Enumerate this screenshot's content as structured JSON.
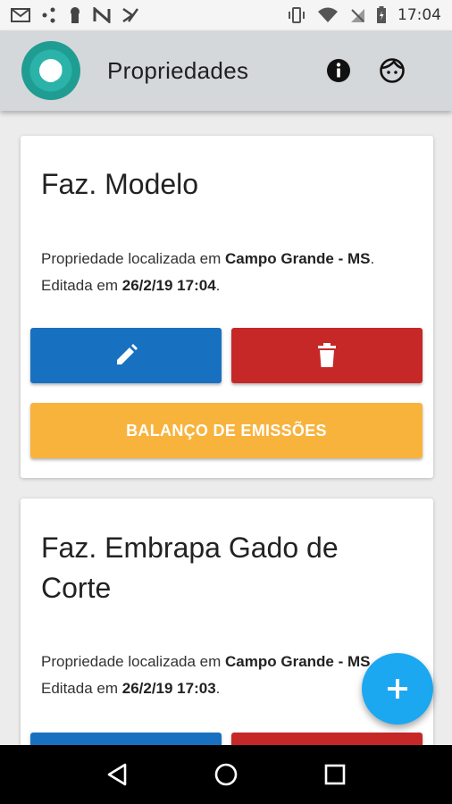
{
  "status_bar": {
    "time": "17:04",
    "icons": [
      "gmail-icon",
      "share-icon",
      "keyhole-icon",
      "app-n-icon",
      "app-check-icon",
      "vibrate-icon",
      "wifi-icon",
      "no-sim-icon",
      "battery-icon"
    ]
  },
  "app_bar": {
    "title": "Propriedades",
    "icons": [
      "info-icon",
      "face-icon"
    ]
  },
  "properties": [
    {
      "name": "Faz. Modelo",
      "desc_prefix": "Propriedade localizada em ",
      "location": "Campo Grande - MS",
      "desc_mid": ". Editada em ",
      "edited": "26/2/19 17:04",
      "desc_suffix": ".",
      "balance_label": "BALANÇO DE EMISSÕES"
    },
    {
      "name_line1": "Faz. Embrapa Gado de",
      "name_line2": "Corte",
      "desc_prefix": "Propriedade localizada em ",
      "location": "Campo Grande - MS",
      "desc_mid": ". Editada em ",
      "edited": "26/2/19 17:03",
      "desc_suffix": "."
    }
  ],
  "colors": {
    "edit": "#1871c0",
    "delete": "#c62828",
    "balance": "#f8b33d",
    "fab": "#1ba8f0",
    "app_bar": "#d5d8db"
  },
  "fab": {
    "icon": "plus-icon"
  },
  "nav_bar": {
    "icons": [
      "back-icon",
      "home-icon",
      "recents-icon"
    ]
  }
}
